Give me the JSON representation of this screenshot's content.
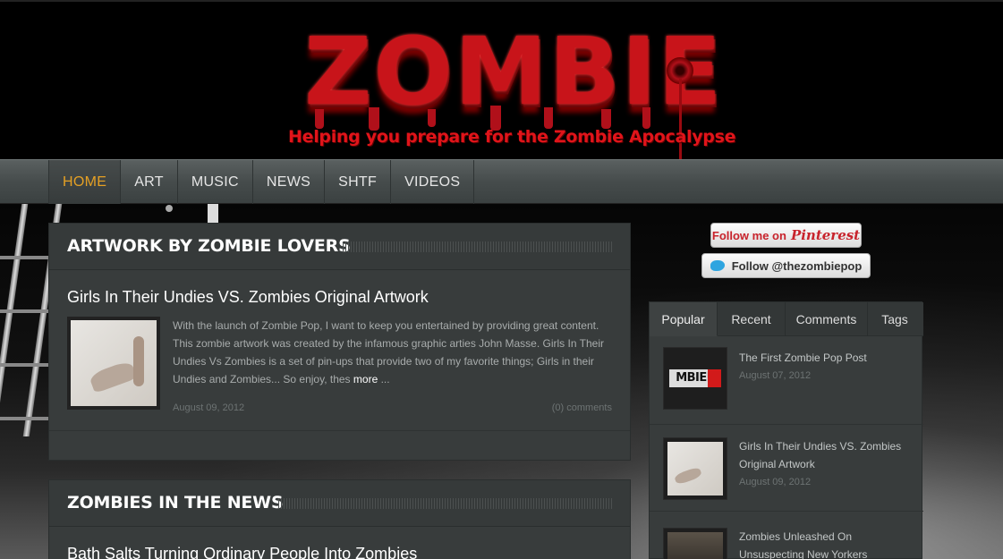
{
  "header": {
    "logo_text": "ZOMBIE",
    "tagline": "Helping you prepare for the Zombie Apocalypse"
  },
  "nav": {
    "items": [
      {
        "label": "HOME",
        "active": true
      },
      {
        "label": "ART"
      },
      {
        "label": "MUSIC"
      },
      {
        "label": "NEWS"
      },
      {
        "label": "SHTF"
      },
      {
        "label": "VIDEOS"
      }
    ]
  },
  "main": {
    "sections": [
      {
        "title": "ARTWORK BY ZOMBIE LOVERS",
        "post": {
          "title": "Girls In Their Undies VS. Zombies Original Artwork",
          "excerpt": "With the launch of Zombie Pop, I want to keep you entertained by providing great content. This zombie artwork was created by the infamous graphic arties John Masse.  Girls In Their Undies Vs Zombies is a set of pin-ups that provide two of my favorite things; Girls in their Undies and Zombies... So enjoy, thes",
          "more_label": "more",
          "ellipsis": " ...",
          "date": "August 09, 2012",
          "comments": "(0) comments"
        }
      },
      {
        "title": "ZOMBIES IN THE NEWS",
        "post": {
          "title": "Bath Salts Turning Ordinary People Into Zombies"
        }
      }
    ]
  },
  "sidebar": {
    "pinterest_label": "Follow me on",
    "pinterest_logo": "Pinterest",
    "twitter_label": "Follow @thezombiepop",
    "tabs": [
      {
        "label": "Popular",
        "active": true
      },
      {
        "label": "Recent"
      },
      {
        "label": "Comments"
      },
      {
        "label": "Tags"
      }
    ],
    "posts": [
      {
        "title": "The First Zombie Pop Post",
        "date": "August 07, 2012",
        "thumb_text": "MBIEP"
      },
      {
        "title": "Girls In Their Undies VS. Zombies Original Artwork",
        "date": "August 09, 2012"
      },
      {
        "title": "Zombies Unleashed On Unsuspecting New Yorkers",
        "date": ""
      }
    ]
  },
  "colors": {
    "accent_active_nav": "#e5a024",
    "logo_red": "#c8141a",
    "panel_bg": "#383c3c"
  }
}
